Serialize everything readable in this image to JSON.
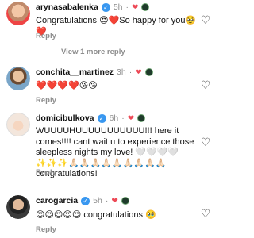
{
  "colors": {
    "heart": "#ed4956",
    "verified": "#3897f0",
    "muted": "#8e8e8e"
  },
  "comments": [
    {
      "username": "arynasabalenka",
      "verified": true,
      "time": "5h",
      "text": "Congratulations 😍❤️So happy for you🥹❤️",
      "reply_label": "Reply",
      "view_more": "View 1 more reply"
    },
    {
      "username": "conchita__martinez",
      "verified": false,
      "time": "3h",
      "text": "❤️❤️❤️❤️😘😘",
      "reply_label": "Reply"
    },
    {
      "username": "domicibulkova",
      "verified": true,
      "time": "6h",
      "text": "WUUUUHUUUUUUUUUUU!!! here it comes!!!! cant wait u to experience those sleepless nights my love! 🤍🤍🤍🤍✨✨✨🙏🏻🙏🏻🙏🏻🙏🏻🙏🏻🙏🏻🙏🏻🙏🏻🙏🏻 congratulations!",
      "reply_label": "Reply"
    },
    {
      "username": "carogarcia",
      "verified": true,
      "time": "5h",
      "text": "😍😍😍😍😍 congratulations 🥹",
      "reply_label": "Reply"
    }
  ],
  "icons": {
    "like": "heart-outline-icon",
    "verified": "verified-badge-icon"
  }
}
